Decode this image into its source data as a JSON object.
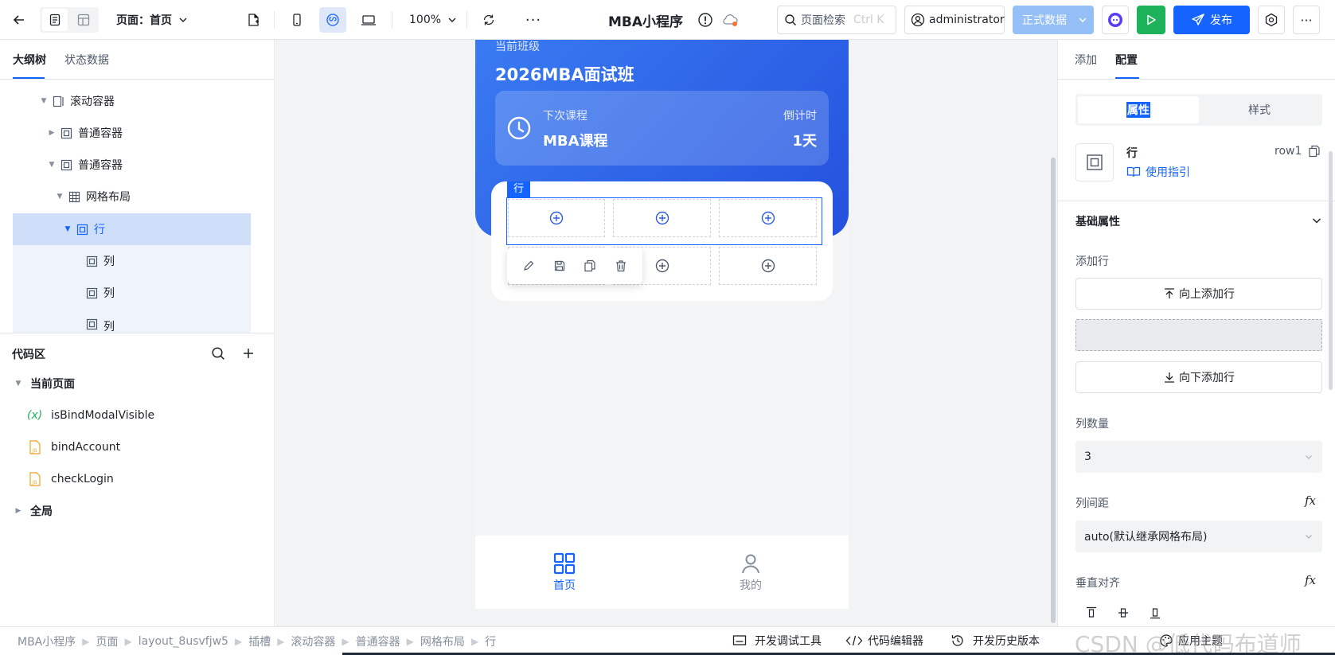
{
  "topbar": {
    "page_label": "页面：首页",
    "zoom": "100%",
    "app_title": "MBA小程序",
    "search_placeholder": "页面检索",
    "search_shortcut": "Ctrl K",
    "user": "administrator",
    "env_label": "正式数据",
    "publish_label": "发布"
  },
  "left": {
    "tabs": [
      "大纲树",
      "状态数据"
    ],
    "tree": [
      {
        "label": "滚动容器",
        "icon": "scroll-container-icon"
      },
      {
        "label": "普通容器",
        "icon": "container-icon"
      },
      {
        "label": "普通容器",
        "icon": "container-icon"
      },
      {
        "label": "网格布局",
        "icon": "grid-icon"
      },
      {
        "label": "行",
        "icon": "container-icon"
      },
      {
        "label": "列",
        "icon": "container-icon"
      },
      {
        "label": "列",
        "icon": "container-icon"
      },
      {
        "label": "列",
        "icon": "container-icon"
      }
    ],
    "code_title": "代码区",
    "code_sections": {
      "current_page": "当前页面",
      "items": [
        "isBindModalVisible",
        "bindAccount",
        "checkLogin"
      ],
      "global": "全局"
    }
  },
  "phone": {
    "class_label": "当前班级",
    "class_name": "2026MBA面试班",
    "next_label": "下次课程",
    "next_value": "MBA课程",
    "countdown_label": "倒计时",
    "countdown_value": "1天",
    "row_tag": "行",
    "nav": [
      {
        "label": "首页",
        "active": true
      },
      {
        "label": "我的",
        "active": false
      }
    ]
  },
  "right": {
    "tabs": [
      "添加",
      "配置"
    ],
    "segment": [
      "属性",
      "样式"
    ],
    "component_name": "行",
    "component_id": "row1",
    "guide_label": "使用指引",
    "section_title": "基础属性",
    "add_row_label": "添加行",
    "add_up": "向上添加行",
    "add_down": "向下添加行",
    "col_count_label": "列数量",
    "col_count_value": "3",
    "col_gap_label": "列间距",
    "col_gap_value": "auto(默认继承网格布局)",
    "valign_label": "垂直对齐"
  },
  "bottombar": {
    "breadcrumbs": [
      "MBA小程序",
      "页面",
      "layout_8usvfjw5",
      "插槽",
      "滚动容器",
      "普通容器",
      "网格布局",
      "行"
    ],
    "debug_tool": "开发调试工具",
    "code_editor": "代码编辑器",
    "history": "开发历史版本",
    "theme": "应用主题"
  },
  "watermark": "CSDN @低代码布道师",
  "colors": {
    "primary": "#1664ff",
    "accent_blue": "#2d5be3",
    "run_green": "#1cb35b"
  }
}
